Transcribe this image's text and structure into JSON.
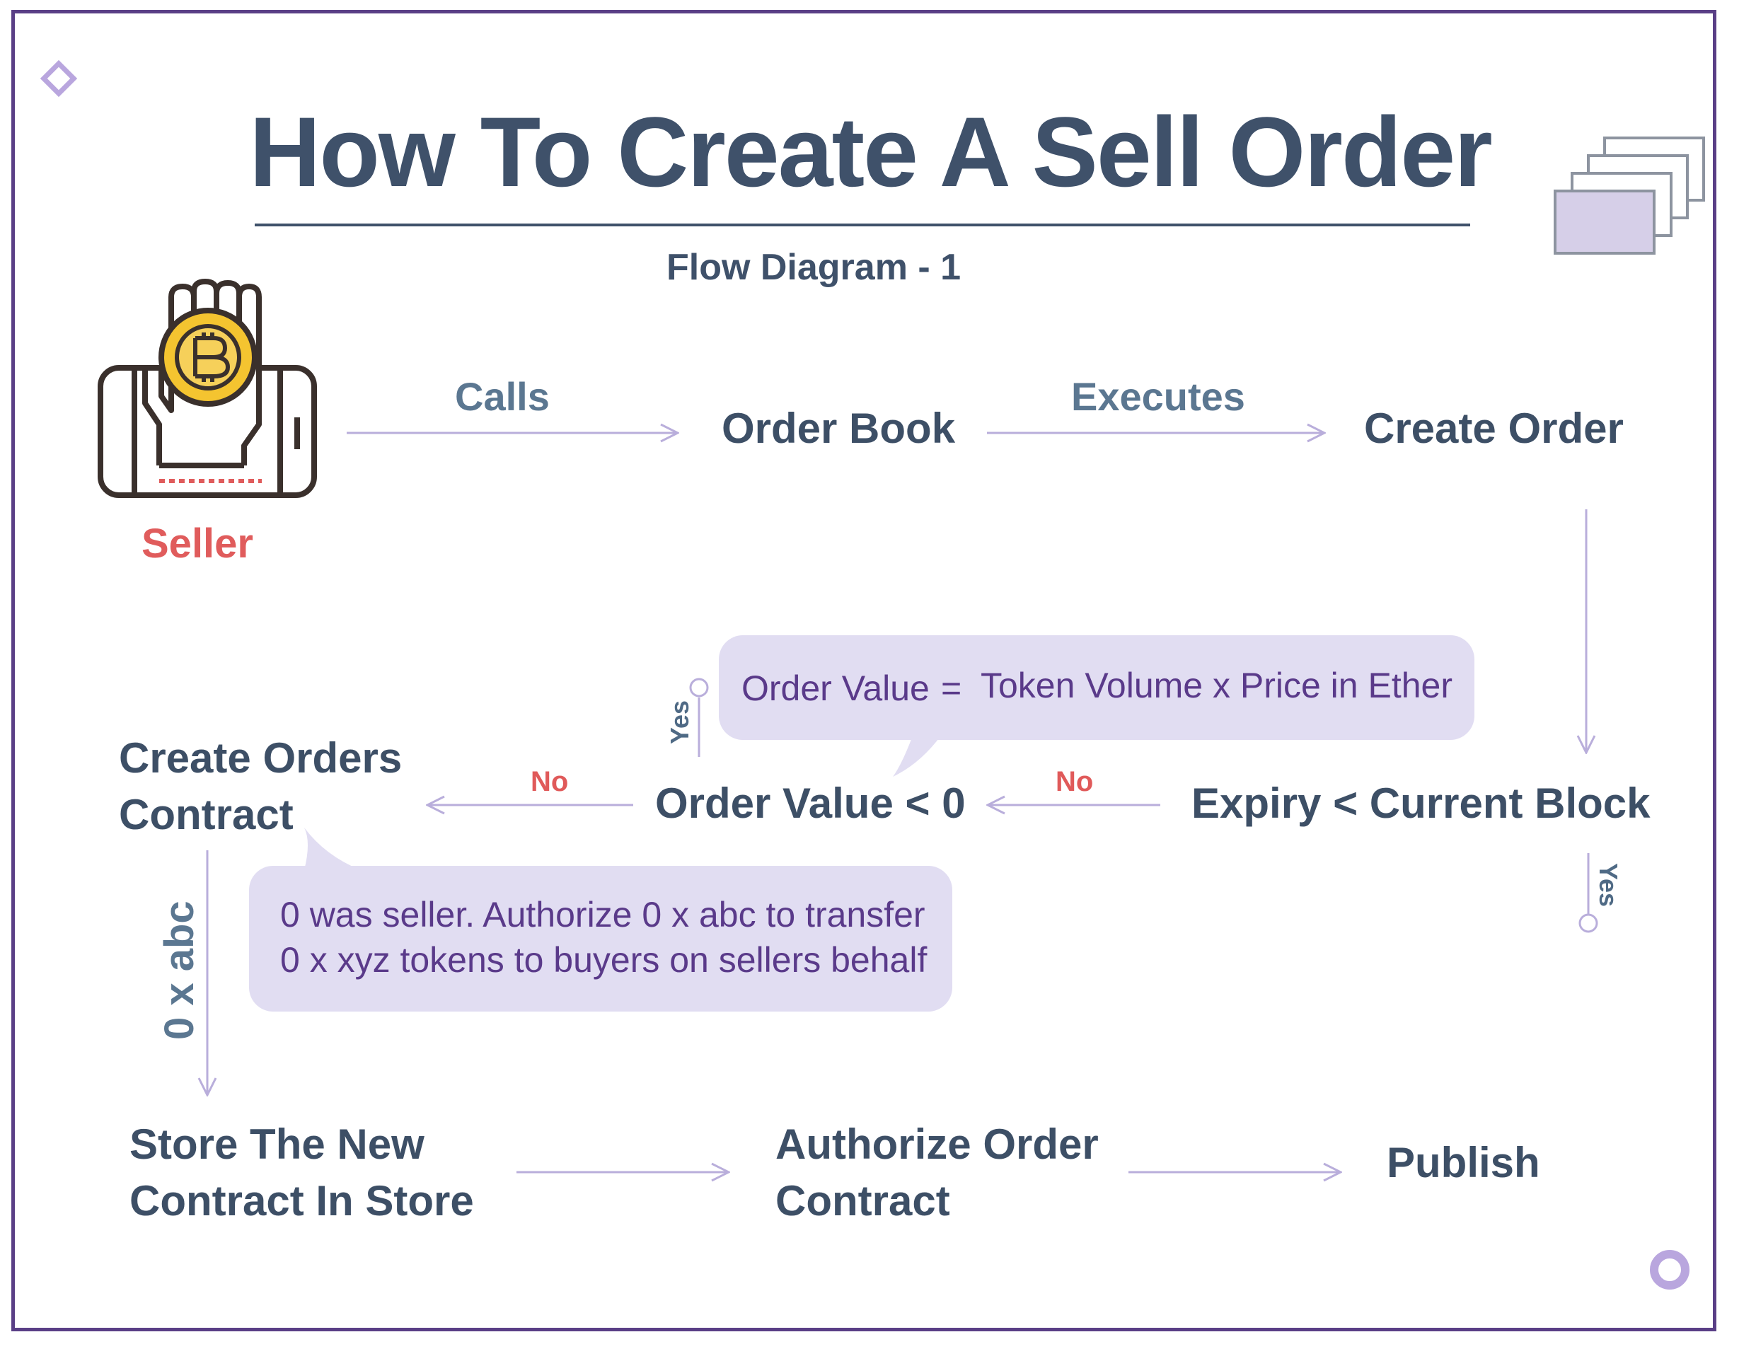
{
  "title": "How To Create A Sell Order",
  "subtitle": "Flow Diagram - 1",
  "seller": {
    "label": "Seller"
  },
  "edges": {
    "calls": "Calls",
    "executes": "Executes",
    "no_1": "No",
    "no_2": "No",
    "yes_top": "Yes",
    "yes_right": "Yes",
    "address": "0 x abc"
  },
  "nodes": {
    "order_book": "Order Book",
    "create_order": "Create Order",
    "expiry_check": "Expiry < Current Block",
    "order_value_check": "Order Value < 0",
    "create_orders_contract": [
      "Create Orders",
      "Contract"
    ],
    "store_contract": [
      "Store The New",
      "Contract In Store"
    ],
    "authorize_contract": [
      "Authorize Order",
      "Contract"
    ],
    "publish": "Publish"
  },
  "notes": {
    "order_value_formula": {
      "lhs": "Order Value",
      "eq": "=",
      "rhs": "Token Volume x Price in Ether"
    },
    "authorization": [
      "0 was seller. Authorize 0 x abc to transfer",
      "0 x xyz tokens to buyers on sellers behalf"
    ]
  },
  "colors": {
    "frame": "#5a3f86",
    "title": "#3f516a",
    "arrow": "#b9aedb",
    "bubble": "#e1ddf2",
    "no": "#e05a5a",
    "seller": "#e05c5c",
    "coin": "#f4c430"
  }
}
